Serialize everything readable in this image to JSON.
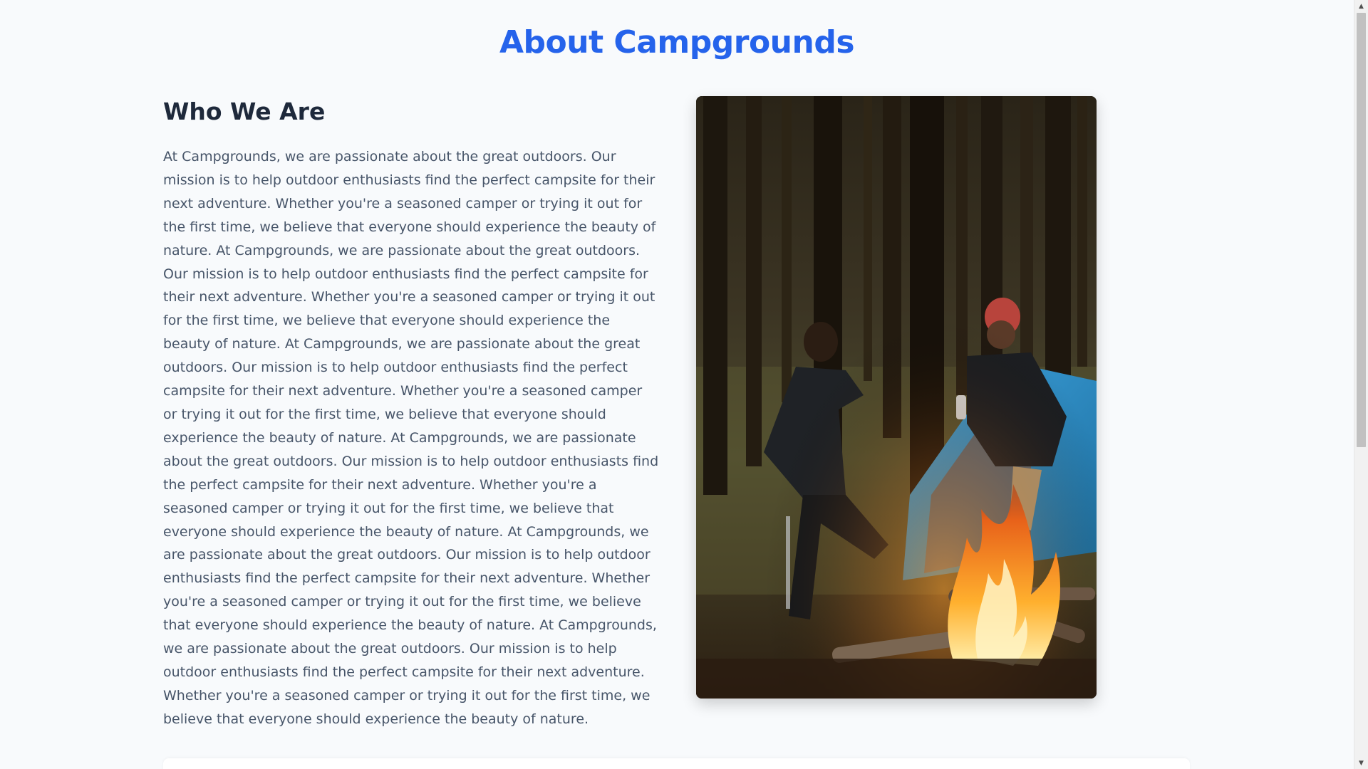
{
  "page": {
    "title": "About Campgrounds"
  },
  "about": {
    "heading": "Who We Are",
    "body": "At Campgrounds, we are passionate about the great outdoors. Our mission is to help outdoor enthusiasts find the perfect campsite for their next adventure. Whether you're a seasoned camper or trying it out for the first time, we believe that everyone should experience the beauty of nature. At Campgrounds, we are passionate about the great outdoors. Our mission is to help outdoor enthusiasts find the perfect campsite for their next adventure. Whether you're a seasoned camper or trying it out for the first time, we believe that everyone should experience the beauty of nature. At Campgrounds, we are passionate about the great outdoors. Our mission is to help outdoor enthusiasts find the perfect campsite for their next adventure. Whether you're a seasoned camper or trying it out for the first time, we believe that everyone should experience the beauty of nature. At Campgrounds, we are passionate about the great outdoors. Our mission is to help outdoor enthusiasts find the perfect campsite for their next adventure. Whether you're a seasoned camper or trying it out for the first time, we believe that everyone should experience the beauty of nature. At Campgrounds, we are passionate about the great outdoors. Our mission is to help outdoor enthusiasts find the perfect campsite for their next adventure. Whether you're a seasoned camper or trying it out for the first time, we believe that everyone should experience the beauty of nature. At Campgrounds, we are passionate about the great outdoors. Our mission is to help outdoor enthusiasts find the perfect campsite for their next adventure. Whether you're a seasoned camper or trying it out for the first time, we believe that everyone should experience the beauty of nature."
  },
  "icons": {
    "scroll_up": "scroll-up-arrow-icon",
    "scroll_down": "scroll-down-arrow-icon"
  },
  "colors": {
    "title": "#2563eb",
    "heading": "#1e293b",
    "body_text": "#475569",
    "background": "#f8fafc"
  }
}
